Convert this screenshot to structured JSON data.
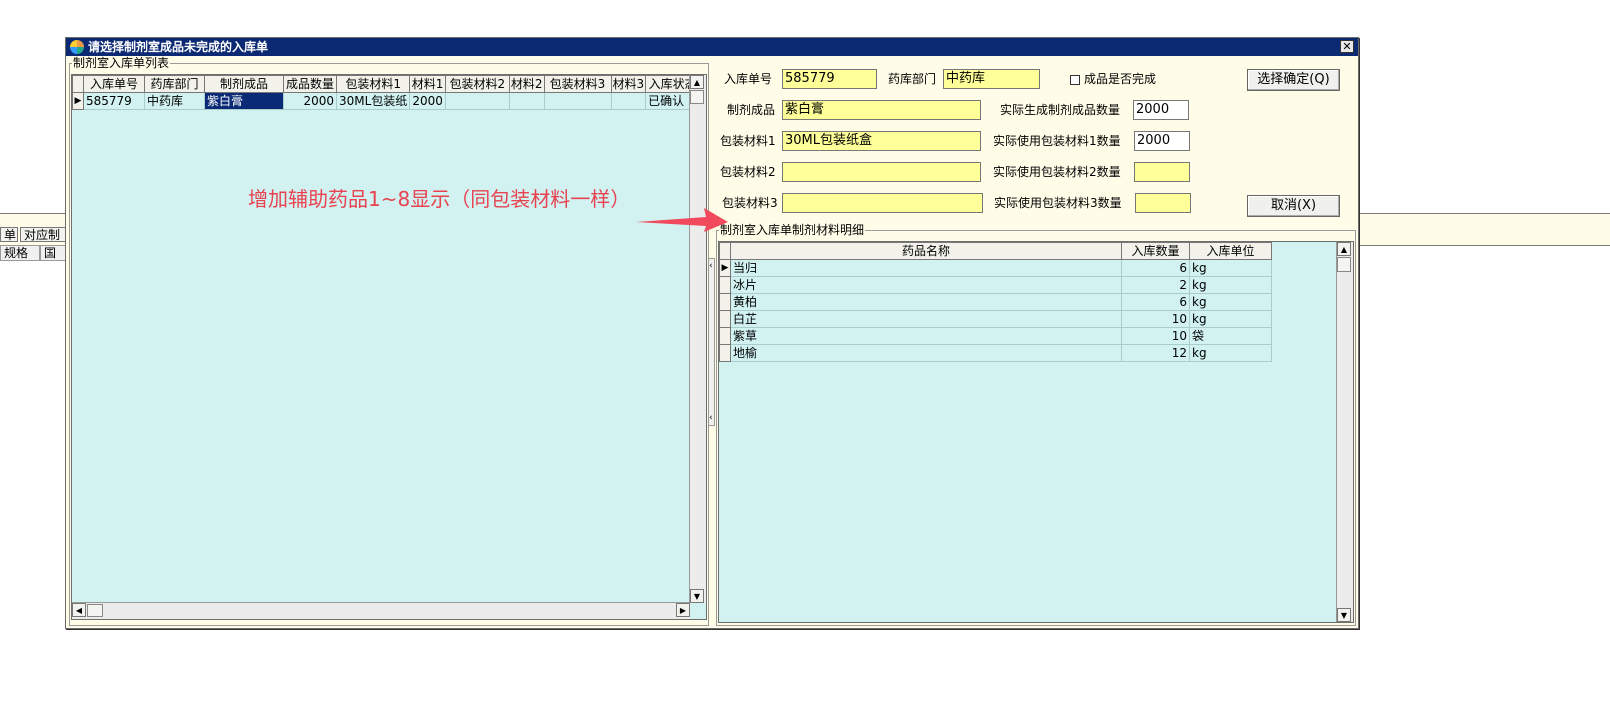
{
  "background": {
    "tabs": [
      "单",
      "对应制"
    ],
    "columns": [
      "规格",
      "国"
    ]
  },
  "dialog": {
    "title": "请选择制剂室成品未完成的入库单",
    "close_label": "✕"
  },
  "list_panel": {
    "legend": "制剂室入库单列表",
    "columns": [
      "入库单号",
      "药库部门",
      "制剂成品",
      "成品数量",
      "包装材料1",
      "材料1",
      "包装材料2",
      "材料2",
      "包装材料3",
      "材料3",
      "入库状态"
    ],
    "rows": [
      [
        "585779",
        "中药库",
        "紫白膏",
        "2000",
        "30ML包装纸",
        "2000",
        "",
        "",
        "",
        "",
        "已确认"
      ]
    ]
  },
  "form": {
    "order_no_label": "入库单号",
    "order_no_value": "585779",
    "dept_label": "药库部门",
    "dept_value": "中药库",
    "finished_checkbox_label": "成品是否完成",
    "product_label": "制剂成品",
    "product_value": "紫白膏",
    "actual_qty_label": "实际生成制剂成品数量",
    "actual_qty_value": "2000",
    "pack1_label": "包装材料1",
    "pack1_value": "30ML包装纸盒",
    "pack1_qty_label": "实际使用包装材料1数量",
    "pack1_qty_value": "2000",
    "pack2_label": "包装材料2",
    "pack2_value": "",
    "pack2_qty_label": "实际使用包装材料2数量",
    "pack2_qty_value": "",
    "pack3_label": "包装材料3",
    "pack3_value": "",
    "pack3_qty_label": "实际使用包装材料3数量",
    "pack3_qty_value": "",
    "confirm_button": "选择确定(Q)",
    "cancel_button": "取消(X)"
  },
  "detail_panel": {
    "legend": "制剂室入库单制剂材料明细",
    "columns": [
      "药品名称",
      "入库数量",
      "入库单位"
    ],
    "rows": [
      [
        "当归",
        "6",
        "kg"
      ],
      [
        "冰片",
        "2",
        "kg"
      ],
      [
        "黄柏",
        "6",
        "kg"
      ],
      [
        "白芷",
        "10",
        "kg"
      ],
      [
        "紫草",
        "10",
        "袋"
      ],
      [
        "地榆",
        "12",
        "kg"
      ]
    ]
  },
  "annotation": {
    "text": "增加辅助药品1~8显示（同包装材料一样）",
    "color": "#e8424f"
  },
  "colors": {
    "title_bar": "#0c2a73",
    "grid_bg": "#d2f2f2",
    "field_yellow": "#ffff99",
    "selection": "#0a2a75"
  }
}
